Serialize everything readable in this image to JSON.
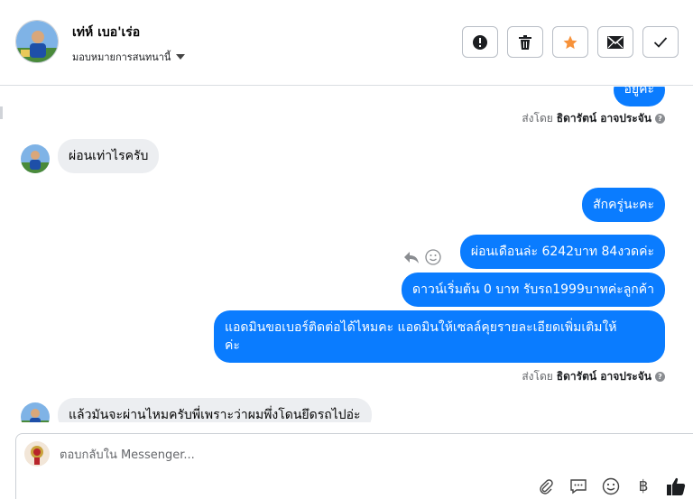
{
  "header": {
    "contact_name": "เท่ห์ เบอ'เร่อ",
    "assign_label": "มอบหมายการสนทนานี้",
    "actions": [
      {
        "name": "mark-spam-button",
        "icon": "alert-circle-icon"
      },
      {
        "name": "delete-button",
        "icon": "trash-icon"
      },
      {
        "name": "star-button",
        "icon": "star-icon"
      },
      {
        "name": "mark-unread-button",
        "icon": "envelope-icon"
      },
      {
        "name": "mark-done-button",
        "icon": "check-icon"
      }
    ]
  },
  "messages": {
    "m1": "อยู่คะ",
    "sent1": {
      "prefix": "ส่งโดย",
      "sender": "ธิดารัตน์ อาจประจัน"
    },
    "m2": "ผ่อนเท่าไรครับ",
    "m3": "สักครู่นะคะ",
    "m4": "ผ่อนเดือนล่ะ 6242บาท 84งวดค่ะ",
    "m5": "ดาวน์เริ่มต้น 0 บาท รับรถ1999บาทค่ะลูกค้า",
    "m6_line1": "แอดมินขอเบอร์ติดต่อได้ไหมคะ แอดมินให้เซลล์คุยรายละเอียดเพิ่มเติมให้",
    "m6_line2": "ค่ะ",
    "sent2": {
      "prefix": "ส่งโดย",
      "sender": "ธิดารัตน์ อาจประจัน"
    },
    "m7": "แล้วมันจะผ่านไหมครับพี่เพราะว่าผมพึ่งโดนยึดรถไปอ่ะ"
  },
  "composer": {
    "placeholder": "ตอบกลับใน Messenger...",
    "currency_symbol": "฿"
  },
  "colors": {
    "outgoing_bubble": "#0a7cff",
    "incoming_bubble": "#eceef1",
    "star": "#f7923a"
  }
}
